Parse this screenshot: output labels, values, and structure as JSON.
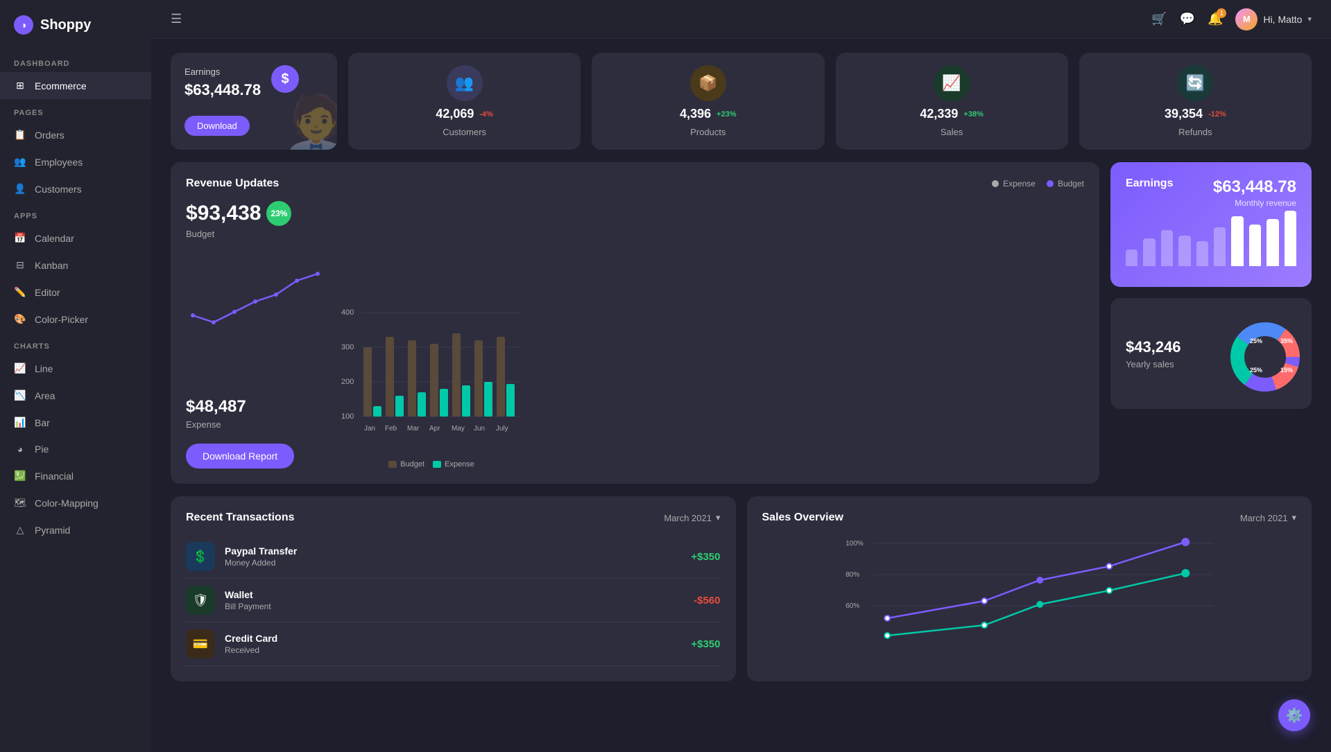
{
  "app": {
    "name": "Shoppy",
    "logo_icon": "◑"
  },
  "header": {
    "hamburger_label": "☰",
    "user": {
      "greeting": "Hi, Matto",
      "avatar_initials": "M",
      "chevron": "▾"
    },
    "icons": {
      "cart": "🛒",
      "message": "💬",
      "notification": "🔔",
      "notification_count": "1"
    }
  },
  "sidebar": {
    "sections": [
      {
        "label": "DASHBOARD",
        "items": [
          {
            "id": "ecommerce",
            "label": "Ecommerce",
            "icon": "⊞",
            "active": true
          }
        ]
      },
      {
        "label": "PAGES",
        "items": [
          {
            "id": "orders",
            "label": "Orders",
            "icon": "📋"
          },
          {
            "id": "employees",
            "label": "Employees",
            "icon": "👥"
          },
          {
            "id": "customers",
            "label": "Customers",
            "icon": "👤"
          }
        ]
      },
      {
        "label": "APPS",
        "items": [
          {
            "id": "calendar",
            "label": "Calendar",
            "icon": "📅"
          },
          {
            "id": "kanban",
            "label": "Kanban",
            "icon": "⊟"
          },
          {
            "id": "editor",
            "label": "Editor",
            "icon": "✏️"
          },
          {
            "id": "color-picker",
            "label": "Color-Picker",
            "icon": "🎨"
          }
        ]
      },
      {
        "label": "CHARTS",
        "items": [
          {
            "id": "line",
            "label": "Line",
            "icon": "📈"
          },
          {
            "id": "area",
            "label": "Area",
            "icon": "📉"
          },
          {
            "id": "bar",
            "label": "Bar",
            "icon": "📊"
          },
          {
            "id": "pie",
            "label": "Pie",
            "icon": "◕"
          },
          {
            "id": "financial",
            "label": "Financial",
            "icon": "💹"
          },
          {
            "id": "color-mapping",
            "label": "Color-Mapping",
            "icon": "🗺"
          },
          {
            "id": "pyramid",
            "label": "Pyramid",
            "icon": "△"
          }
        ]
      }
    ]
  },
  "earnings_card": {
    "label": "Earnings",
    "value": "$63,448.78",
    "download_label": "Download",
    "icon": "$"
  },
  "stat_cards": [
    {
      "id": "customers",
      "value": "42,069",
      "pct": "-4%",
      "pct_type": "neg",
      "label": "Customers",
      "icon": "👥",
      "bg": "#3d3d5c"
    },
    {
      "id": "products",
      "value": "4,396",
      "pct": "+23%",
      "pct_type": "pos",
      "label": "Products",
      "icon": "📦",
      "bg": "#4a3a1a"
    },
    {
      "id": "sales",
      "value": "42,339",
      "pct": "+38%",
      "pct_type": "pos",
      "label": "Sales",
      "icon": "📈",
      "bg": "#2a3a2a"
    },
    {
      "id": "refunds",
      "value": "39,354",
      "pct": "-12%",
      "pct_type": "neg",
      "label": "Refunds",
      "icon": "🔄",
      "bg": "#2a3a3a"
    }
  ],
  "revenue_updates": {
    "title": "Revenue Updates",
    "legend_expense": "Expense",
    "legend_budget": "Budget",
    "budget_value": "$93,438",
    "budget_pct": "23%",
    "budget_label": "Budget",
    "expense_value": "$48,487",
    "expense_label": "Expense",
    "download_btn": "Download Report",
    "chart_labels": [
      "Jan",
      "Feb",
      "Mar",
      "Apr",
      "May",
      "Jun",
      "July"
    ],
    "chart_y_labels": [
      "400",
      "300",
      "200",
      "100"
    ],
    "budget_legend": "Budget",
    "expense_legend": "Expense"
  },
  "earnings_purple": {
    "title": "Earnings",
    "value": "$63,448.78",
    "sub_label": "Monthly revenue",
    "bars": [
      30,
      50,
      65,
      55,
      45,
      70,
      90,
      75,
      85,
      100
    ]
  },
  "yearly_sales": {
    "value": "$43,246",
    "label": "Yearly sales",
    "segments": [
      {
        "pct": "35%",
        "color": "#7c5cfc"
      },
      {
        "pct": "25%",
        "color": "#00c9a7"
      },
      {
        "pct": "25%",
        "color": "#4e8af5"
      },
      {
        "pct": "15%",
        "color": "#ff6b6b"
      }
    ]
  },
  "recent_transactions": {
    "title": "Recent Transactions",
    "date": "March 2021",
    "items": [
      {
        "id": "paypal",
        "name": "Paypal Transfer",
        "sub": "Money Added",
        "amount": "+$350",
        "type": "pos",
        "icon": "$",
        "icon_bg": "#1a3a5c"
      },
      {
        "id": "wallet",
        "name": "Wallet",
        "sub": "Bill Payment",
        "amount": "-$560",
        "type": "neg",
        "icon": "🛡",
        "icon_bg": "#1a3a2a"
      },
      {
        "id": "credit",
        "name": "Credit Card",
        "sub": "Received",
        "amount": "+$350",
        "type": "pos",
        "icon": "💳",
        "icon_bg": "#3a2a1a"
      }
    ]
  },
  "sales_overview": {
    "title": "Sales Overview",
    "date": "March 2021"
  }
}
